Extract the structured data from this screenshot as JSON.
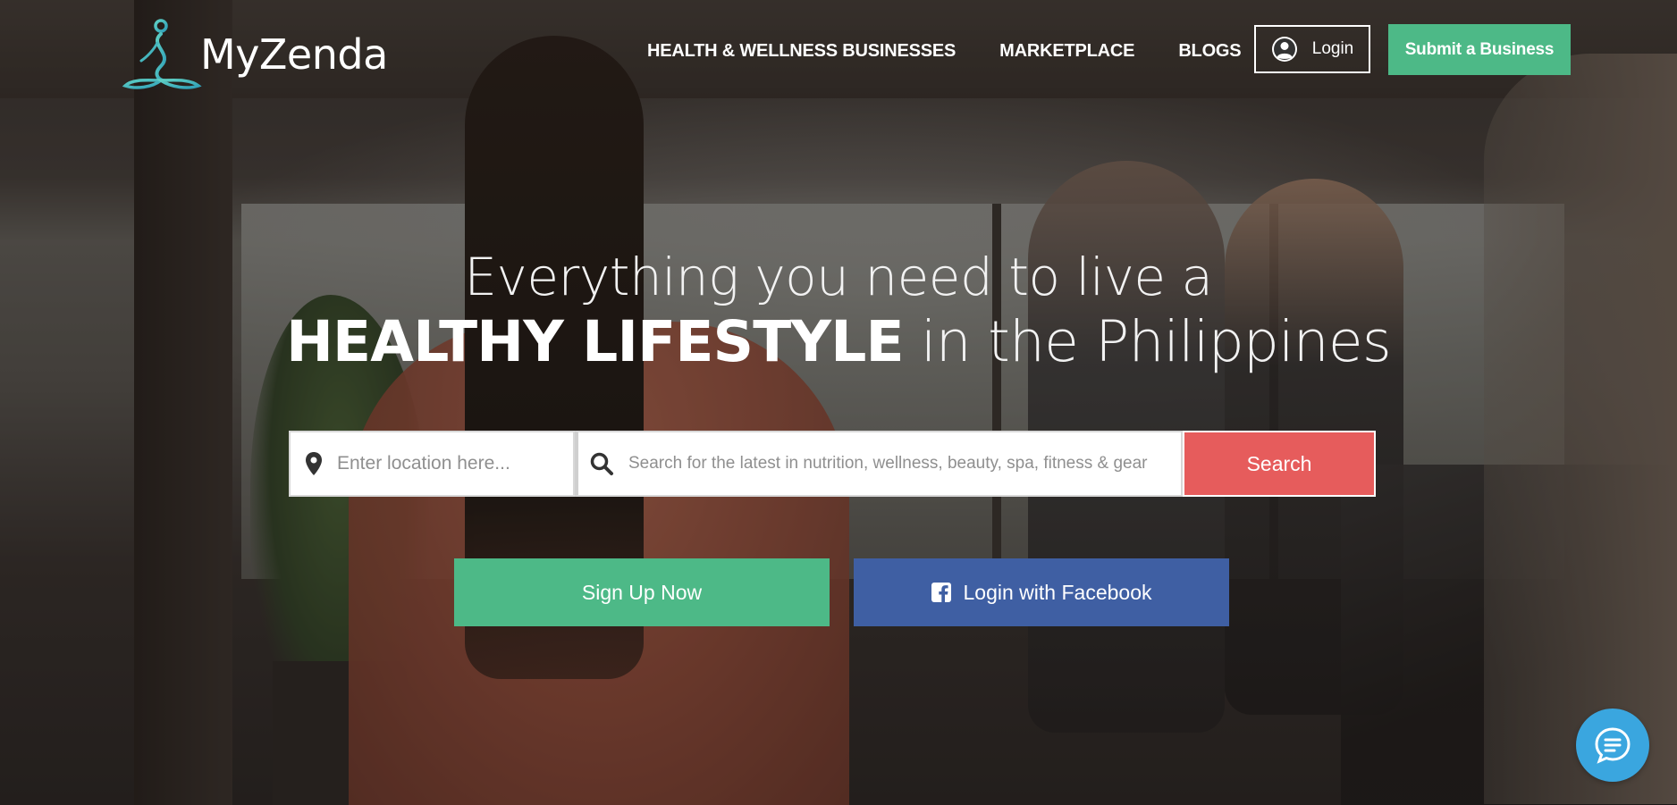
{
  "brand": {
    "name": "MyZenda",
    "logo_icon": "lotus-figure-icon",
    "logo_color": "#3ab8b0"
  },
  "nav": {
    "items": [
      {
        "label": "HEALTH & WELLNESS BUSINESSES"
      },
      {
        "label": "MARKETPLACE"
      },
      {
        "label": "BLOGS"
      }
    ]
  },
  "header": {
    "login_label": "Login",
    "login_icon": "user-circle-icon",
    "submit_label": "Submit a Business",
    "submit_color": "#4db987"
  },
  "hero": {
    "line1": "Everything you need to live a",
    "line2_strong": "HEALTHY LIFESTYLE",
    "line2_light": " in the Philippines"
  },
  "search": {
    "location_placeholder": "Enter location here...",
    "location_value": "",
    "location_icon": "map-pin-icon",
    "query_placeholder": "Search for the latest in nutrition, wellness, beauty, spa, fitness & gear",
    "query_value": "",
    "query_icon": "search-icon",
    "button_label": "Search",
    "button_color": "#e65c5c"
  },
  "cta": {
    "signup_label": "Sign Up Now",
    "signup_color": "#4db987",
    "facebook_label": "Login with Facebook",
    "facebook_icon": "facebook-icon",
    "facebook_color": "#3f5fa3"
  },
  "chat": {
    "icon": "chat-bubble-icon",
    "color": "#3aa6df"
  }
}
